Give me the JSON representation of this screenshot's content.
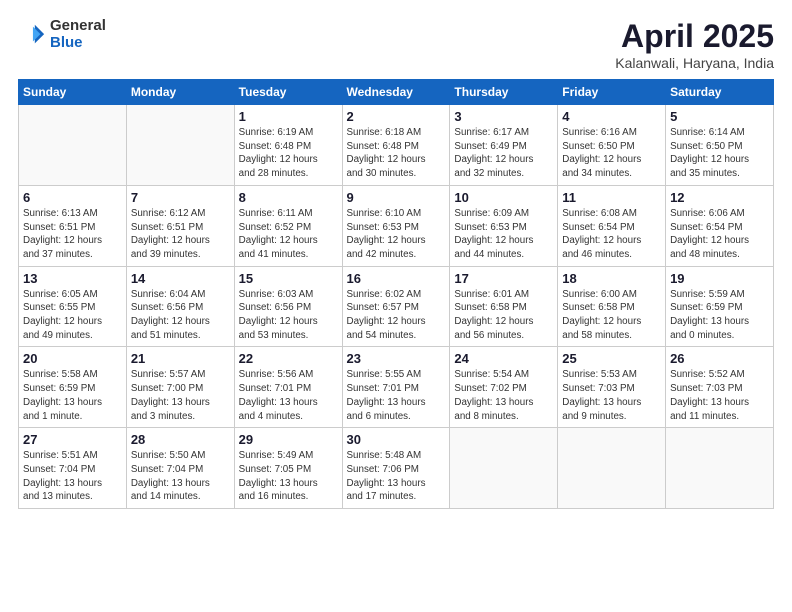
{
  "logo": {
    "general": "General",
    "blue": "Blue"
  },
  "header": {
    "month": "April 2025",
    "location": "Kalanwali, Haryana, India"
  },
  "weekdays": [
    "Sunday",
    "Monday",
    "Tuesday",
    "Wednesday",
    "Thursday",
    "Friday",
    "Saturday"
  ],
  "weeks": [
    [
      {
        "day": "",
        "info": ""
      },
      {
        "day": "",
        "info": ""
      },
      {
        "day": "1",
        "info": "Sunrise: 6:19 AM\nSunset: 6:48 PM\nDaylight: 12 hours\nand 28 minutes."
      },
      {
        "day": "2",
        "info": "Sunrise: 6:18 AM\nSunset: 6:48 PM\nDaylight: 12 hours\nand 30 minutes."
      },
      {
        "day": "3",
        "info": "Sunrise: 6:17 AM\nSunset: 6:49 PM\nDaylight: 12 hours\nand 32 minutes."
      },
      {
        "day": "4",
        "info": "Sunrise: 6:16 AM\nSunset: 6:50 PM\nDaylight: 12 hours\nand 34 minutes."
      },
      {
        "day": "5",
        "info": "Sunrise: 6:14 AM\nSunset: 6:50 PM\nDaylight: 12 hours\nand 35 minutes."
      }
    ],
    [
      {
        "day": "6",
        "info": "Sunrise: 6:13 AM\nSunset: 6:51 PM\nDaylight: 12 hours\nand 37 minutes."
      },
      {
        "day": "7",
        "info": "Sunrise: 6:12 AM\nSunset: 6:51 PM\nDaylight: 12 hours\nand 39 minutes."
      },
      {
        "day": "8",
        "info": "Sunrise: 6:11 AM\nSunset: 6:52 PM\nDaylight: 12 hours\nand 41 minutes."
      },
      {
        "day": "9",
        "info": "Sunrise: 6:10 AM\nSunset: 6:53 PM\nDaylight: 12 hours\nand 42 minutes."
      },
      {
        "day": "10",
        "info": "Sunrise: 6:09 AM\nSunset: 6:53 PM\nDaylight: 12 hours\nand 44 minutes."
      },
      {
        "day": "11",
        "info": "Sunrise: 6:08 AM\nSunset: 6:54 PM\nDaylight: 12 hours\nand 46 minutes."
      },
      {
        "day": "12",
        "info": "Sunrise: 6:06 AM\nSunset: 6:54 PM\nDaylight: 12 hours\nand 48 minutes."
      }
    ],
    [
      {
        "day": "13",
        "info": "Sunrise: 6:05 AM\nSunset: 6:55 PM\nDaylight: 12 hours\nand 49 minutes."
      },
      {
        "day": "14",
        "info": "Sunrise: 6:04 AM\nSunset: 6:56 PM\nDaylight: 12 hours\nand 51 minutes."
      },
      {
        "day": "15",
        "info": "Sunrise: 6:03 AM\nSunset: 6:56 PM\nDaylight: 12 hours\nand 53 minutes."
      },
      {
        "day": "16",
        "info": "Sunrise: 6:02 AM\nSunset: 6:57 PM\nDaylight: 12 hours\nand 54 minutes."
      },
      {
        "day": "17",
        "info": "Sunrise: 6:01 AM\nSunset: 6:58 PM\nDaylight: 12 hours\nand 56 minutes."
      },
      {
        "day": "18",
        "info": "Sunrise: 6:00 AM\nSunset: 6:58 PM\nDaylight: 12 hours\nand 58 minutes."
      },
      {
        "day": "19",
        "info": "Sunrise: 5:59 AM\nSunset: 6:59 PM\nDaylight: 13 hours\nand 0 minutes."
      }
    ],
    [
      {
        "day": "20",
        "info": "Sunrise: 5:58 AM\nSunset: 6:59 PM\nDaylight: 13 hours\nand 1 minute."
      },
      {
        "day": "21",
        "info": "Sunrise: 5:57 AM\nSunset: 7:00 PM\nDaylight: 13 hours\nand 3 minutes."
      },
      {
        "day": "22",
        "info": "Sunrise: 5:56 AM\nSunset: 7:01 PM\nDaylight: 13 hours\nand 4 minutes."
      },
      {
        "day": "23",
        "info": "Sunrise: 5:55 AM\nSunset: 7:01 PM\nDaylight: 13 hours\nand 6 minutes."
      },
      {
        "day": "24",
        "info": "Sunrise: 5:54 AM\nSunset: 7:02 PM\nDaylight: 13 hours\nand 8 minutes."
      },
      {
        "day": "25",
        "info": "Sunrise: 5:53 AM\nSunset: 7:03 PM\nDaylight: 13 hours\nand 9 minutes."
      },
      {
        "day": "26",
        "info": "Sunrise: 5:52 AM\nSunset: 7:03 PM\nDaylight: 13 hours\nand 11 minutes."
      }
    ],
    [
      {
        "day": "27",
        "info": "Sunrise: 5:51 AM\nSunset: 7:04 PM\nDaylight: 13 hours\nand 13 minutes."
      },
      {
        "day": "28",
        "info": "Sunrise: 5:50 AM\nSunset: 7:04 PM\nDaylight: 13 hours\nand 14 minutes."
      },
      {
        "day": "29",
        "info": "Sunrise: 5:49 AM\nSunset: 7:05 PM\nDaylight: 13 hours\nand 16 minutes."
      },
      {
        "day": "30",
        "info": "Sunrise: 5:48 AM\nSunset: 7:06 PM\nDaylight: 13 hours\nand 17 minutes."
      },
      {
        "day": "",
        "info": ""
      },
      {
        "day": "",
        "info": ""
      },
      {
        "day": "",
        "info": ""
      }
    ]
  ]
}
